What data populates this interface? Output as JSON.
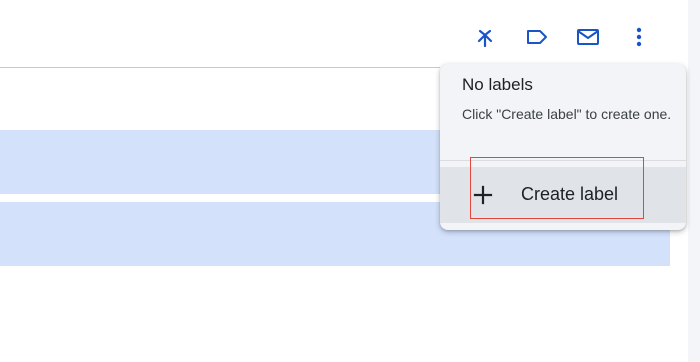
{
  "toolbar": {
    "icons": [
      "merge-icon",
      "label-icon",
      "mail-icon",
      "more-vert-icon"
    ]
  },
  "label_menu": {
    "title": "No labels",
    "description": "Click \"Create label\" to create one.",
    "create_label": "Create label",
    "create_icon": "plus-icon"
  },
  "colors": {
    "accent": "#1a55c8",
    "selected_row": "#d3e1fb",
    "menu_bg": "#f2f4f8",
    "highlight_box": "#e0483e"
  }
}
